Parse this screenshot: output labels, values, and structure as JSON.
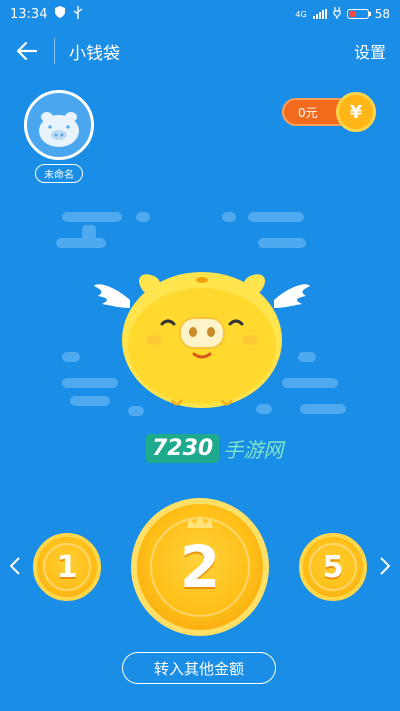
{
  "status_bar": {
    "time": "13:34",
    "network": "4G",
    "battery_level": "58",
    "battery_fraction": 0.2
  },
  "header": {
    "title": "小钱袋",
    "settings_label": "设置"
  },
  "profile": {
    "name": "未命名"
  },
  "balance": {
    "amount": "0元",
    "currency_symbol": "¥"
  },
  "watermark": {
    "number": "7230",
    "text": "手游网"
  },
  "coins": {
    "left": "1",
    "center": "2",
    "right": "5"
  },
  "actions": {
    "other_amount_label": "转入其他金额"
  },
  "colors": {
    "background": "#1a8de6",
    "coin_gold": "#ffc01a",
    "balance_orange": "#f26a1b",
    "watermark_green": "#1eaa8c"
  }
}
